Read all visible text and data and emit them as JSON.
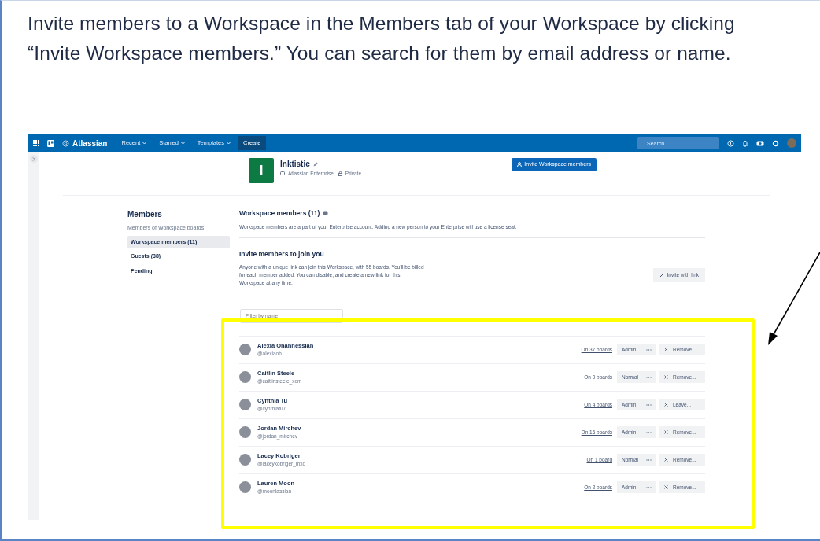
{
  "intro": "Invite members to a Workspace in the Members tab of your Workspace by clicking “Invite Workspace members.” You can search for them by email address or name.",
  "navbar": {
    "logo": "Atlassian",
    "menus": [
      {
        "label": "Recent"
      },
      {
        "label": "Starred"
      },
      {
        "label": "Templates"
      }
    ],
    "create": "Create",
    "search_placeholder": "Search"
  },
  "workspace": {
    "initial": "I",
    "name": "Inktistic",
    "plan": "Atlassian Enterprise",
    "visibility": "Private",
    "invite_button": "Invite Workspace members"
  },
  "sidebar": {
    "title": "Members",
    "caption": "Members of Workspace boards",
    "items": [
      {
        "label": "Workspace members (11)",
        "selected": true
      },
      {
        "label": "Guests (38)",
        "selected": false
      },
      {
        "label": "Pending",
        "selected": false
      }
    ]
  },
  "section": {
    "title": "Workspace members (11)",
    "description": "Workspace members are a part of your Enterprise account. Adding a new person to your Enterprise will use a license seat.",
    "invite_title": "Invite members to join you",
    "invite_text": "Anyone with a unique link can join this Workspace, with 55 boards. You'll be billed for each member added. You can disable, and create a new link for this Workspace at any time.",
    "invite_link_button": "Invite with link",
    "filter_placeholder": "Filter by name"
  },
  "members": [
    {
      "name": "Alexia Ohannessian",
      "handle": "@alexiaoh",
      "boards": "On 37 boards",
      "linked": true,
      "role": "Admin",
      "action": "Remove..."
    },
    {
      "name": "Caitlin Steele",
      "handle": "@caitlinsteele_xdm",
      "boards": "On 0 boards",
      "linked": false,
      "role": "Normal",
      "action": "Remove..."
    },
    {
      "name": "Cynthia Tu",
      "handle": "@cynthiatu7",
      "boards": "On 4 boards",
      "linked": true,
      "role": "Admin",
      "action": "Leave..."
    },
    {
      "name": "Jordan Mirchev",
      "handle": "@jordan_mirchev",
      "boards": "On 16 boards",
      "linked": true,
      "role": "Admin",
      "action": "Remove..."
    },
    {
      "name": "Lacey Kobriger",
      "handle": "@laceykobriger_mxd",
      "boards": "On 1 board",
      "linked": true,
      "role": "Normal",
      "action": "Remove..."
    },
    {
      "name": "Lauren Moon",
      "handle": "@moonlassian",
      "boards": "On 2 boards",
      "linked": true,
      "role": "Admin",
      "action": "Remove..."
    }
  ]
}
